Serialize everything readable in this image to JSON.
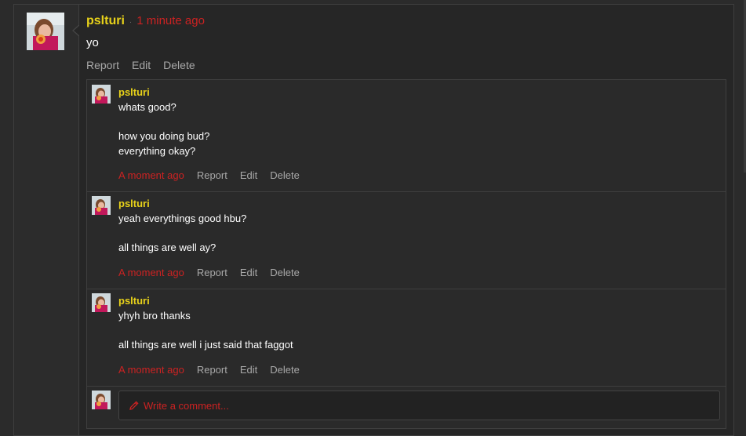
{
  "post": {
    "username": "pslturi",
    "timestamp": "1 minute ago",
    "message": "yo",
    "actions": [
      "Report",
      "Edit",
      "Delete"
    ]
  },
  "replies": [
    {
      "username": "pslturi",
      "lines": [
        "whats good?",
        "",
        "how you doing bud?",
        "everything okay?"
      ],
      "timestamp": "A moment ago",
      "actions": [
        "Report",
        "Edit",
        "Delete"
      ]
    },
    {
      "username": "pslturi",
      "lines": [
        "yeah everythings good hbu?",
        "",
        "all things are well ay?"
      ],
      "timestamp": "A moment ago",
      "actions": [
        "Report",
        "Edit",
        "Delete"
      ]
    },
    {
      "username": "pslturi",
      "lines": [
        "yhyh bro thanks",
        "",
        "all things are well i just said that faggot"
      ],
      "timestamp": "A moment ago",
      "actions": [
        "Report",
        "Edit",
        "Delete"
      ]
    }
  ],
  "compose": {
    "placeholder": "Write a comment...",
    "icon": "pencil-icon"
  },
  "colors": {
    "username": "#e8d21a",
    "timestamp": "#cc2222",
    "action": "#a8a8a8",
    "background": "#262626"
  }
}
